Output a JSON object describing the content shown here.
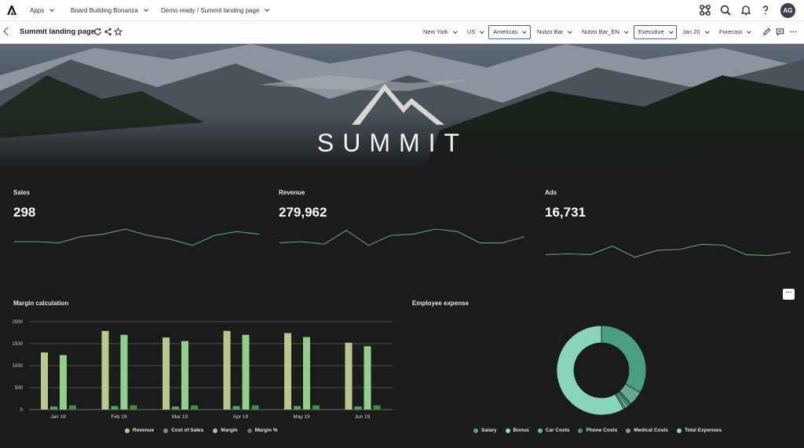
{
  "topbar": {
    "apps_label": "Apps",
    "crumb_board": "Board Building Bonanza",
    "crumb_page": "Demo ready / Summit landing page",
    "avatar_initials": "AG"
  },
  "toolbar": {
    "title": "Summit landing page",
    "filters": [
      "New York",
      "US",
      "Americas",
      "Nutzo Bar",
      "Nutzo Bar_EN",
      "Executive",
      "Jan 20",
      "Forecast"
    ]
  },
  "hero": {
    "brand": "SUMMIT"
  },
  "kpis": [
    {
      "label": "Sales",
      "value": "298",
      "trend": [
        0.5,
        0.5,
        0.45,
        0.7,
        0.8,
        1.0,
        0.75,
        0.6,
        0.35,
        0.75,
        0.9,
        0.8
      ]
    },
    {
      "label": "Revenue",
      "value": "279,962",
      "trend": [
        0.45,
        0.5,
        0.4,
        0.95,
        0.35,
        0.75,
        0.8,
        1.0,
        0.9,
        0.45,
        0.45,
        0.7
      ]
    },
    {
      "label": "Ads",
      "value": "16,731",
      "trend": [
        0.2,
        0.25,
        0.2,
        0.7,
        0.05,
        0.45,
        0.5,
        0.8,
        0.75,
        0.2,
        0.15,
        0.35
      ]
    }
  ],
  "chart_data": [
    {
      "type": "bar",
      "title": "Margin calculation",
      "categories": [
        "Jan 19",
        "Feb 19",
        "Mar 19",
        "Apr 19",
        "May 19",
        "Jun 19"
      ],
      "ylim": [
        0,
        2000
      ],
      "yticks": [
        0,
        500,
        1000,
        1500,
        2000
      ],
      "series": [
        {
          "name": "Revenue",
          "color": "#b9c98e",
          "values": [
            1300,
            1790,
            1640,
            1790,
            1740,
            1520
          ]
        },
        {
          "name": "Cost of Sales",
          "color": "#55a35a",
          "values": [
            70,
            80,
            70,
            80,
            80,
            70
          ]
        },
        {
          "name": "Margin",
          "color": "#8fcf8a",
          "values": [
            1240,
            1700,
            1560,
            1700,
            1650,
            1440
          ]
        },
        {
          "name": "Margin %",
          "color": "#3f8d46",
          "values": [
            95,
            95,
            95,
            95,
            95,
            95
          ]
        }
      ]
    },
    {
      "type": "pie",
      "title": "Employee expense",
      "series": [
        {
          "name": "Salary",
          "color": "#4fa384",
          "value": 0.8
        },
        {
          "name": "Bonus",
          "color": "#92dac6",
          "value": 0.8
        },
        {
          "name": "Car Costs",
          "color": "#5cbfa6",
          "value": 0.8
        },
        {
          "name": "Phone Costs",
          "color": "#3f9a74",
          "value": 0.8
        },
        {
          "name": "Medical Costs",
          "color": "#66a890",
          "value": 5.2
        },
        {
          "name": "Total Expenses",
          "color": "#88d4bc",
          "value": 58.3
        }
      ],
      "remainder_color": "#4a9e82",
      "remainder_value": 33.3
    }
  ],
  "colors": {
    "spark_line": "#5fa67a",
    "grid": "#8a8a8a"
  }
}
